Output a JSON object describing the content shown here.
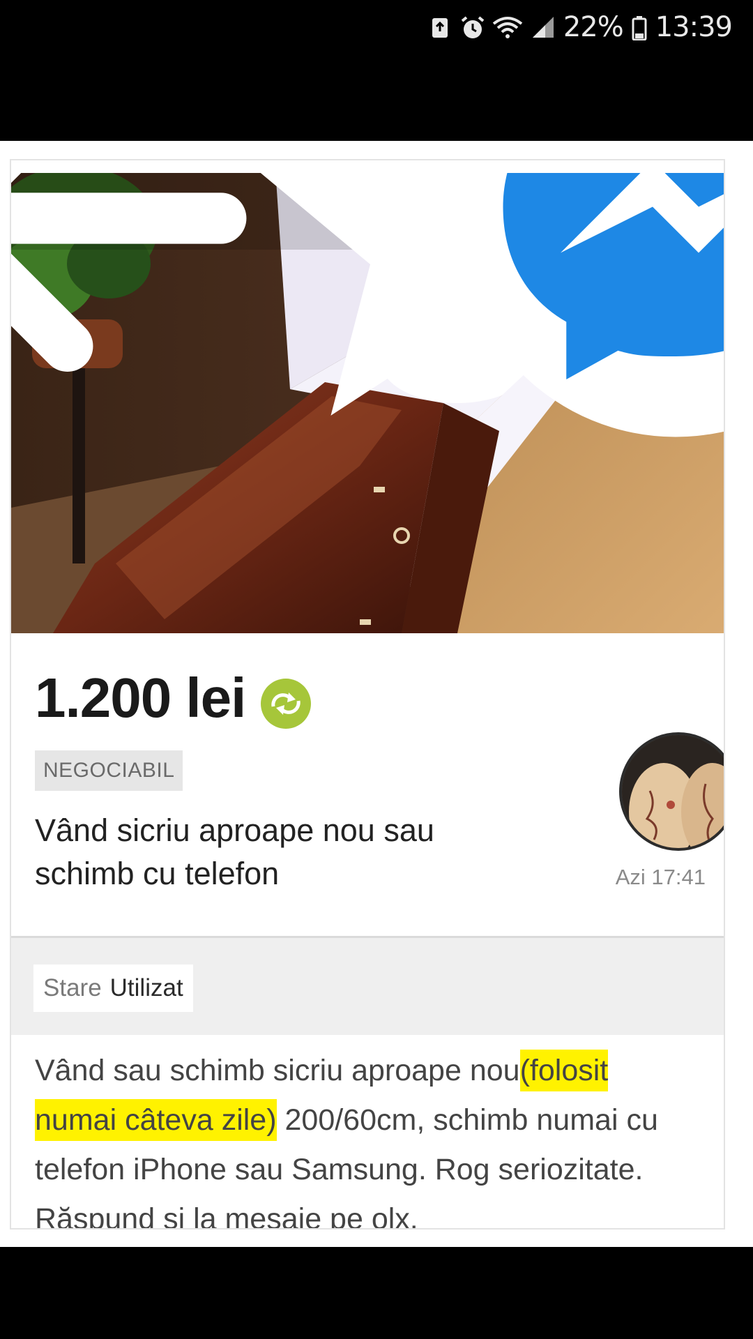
{
  "status_bar": {
    "battery": "22%",
    "time": "13:39",
    "icons": [
      "android-recycle-icon",
      "alarm-icon",
      "wifi-icon",
      "signal-icon",
      "battery-icon"
    ]
  },
  "hero": {
    "image": "photo-coffin",
    "actions": [
      "back-arrow-icon",
      "star-icon",
      "share-icon",
      "messenger-icon"
    ]
  },
  "listing": {
    "price": "1.200 lei",
    "price_icon": "exchange-icon",
    "negotiable": "NEGOCIABIL",
    "title": "Vând sicriu aproape nou sau schimb cu telefon",
    "date": "Azi 17:41"
  },
  "specs": {
    "label": "Stare",
    "value": "Utilizat"
  },
  "description": {
    "part1": "Vând sau schimb sicriu aproape nou",
    "highlight1": "(folosit",
    "highlight2": "numai câteva zile)",
    "part2": " 200/60cm, schimb numai cu telefon iPhone sau Samsung. Rog seriozitate. Răspund și la mesaje pe olx."
  },
  "colors": {
    "accent_green": "#a6c63a",
    "highlight": "#fff200",
    "messenger_blue": "#1e88e5"
  }
}
